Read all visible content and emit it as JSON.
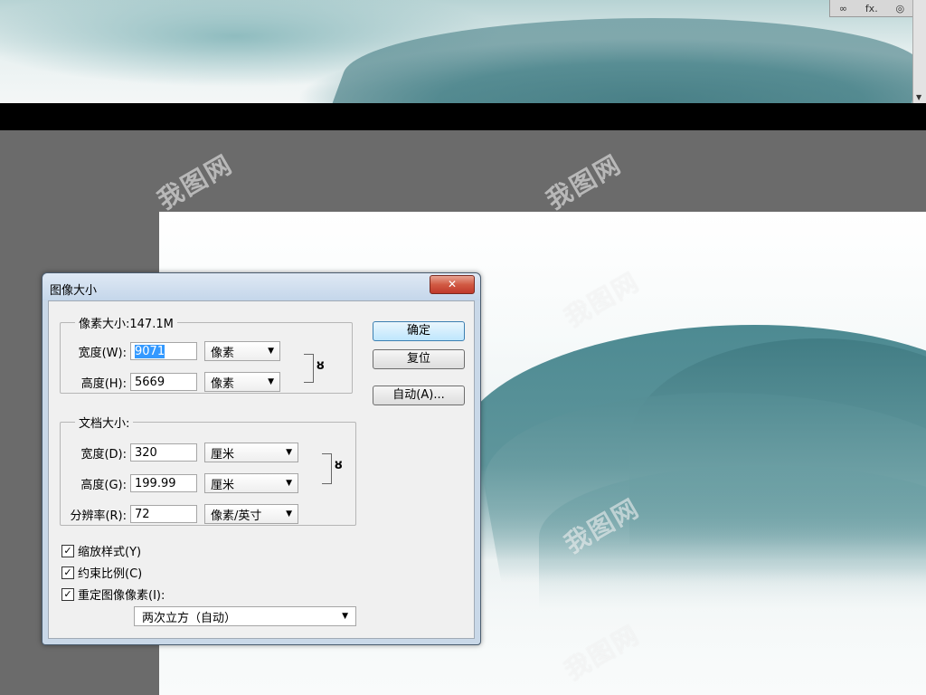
{
  "top_panel": {
    "link_icon": "link-icon",
    "fx_label": "fx",
    "buttons": [
      "∞",
      "fx.",
      "◎"
    ]
  },
  "dialog": {
    "title": "图像大小",
    "close_label": "✕",
    "pixel_dimensions": {
      "legend": "像素大小:147.1M",
      "width": {
        "label": "宽度(W):",
        "value": "9071",
        "unit": "像素"
      },
      "height": {
        "label": "高度(H):",
        "value": "5669",
        "unit": "像素"
      }
    },
    "document_size": {
      "legend": "文档大小:",
      "width": {
        "label": "宽度(D):",
        "value": "320",
        "unit": "厘米"
      },
      "height": {
        "label": "高度(G):",
        "value": "199.99",
        "unit": "厘米"
      },
      "resolution": {
        "label": "分辨率(R):",
        "value": "72",
        "unit": "像素/英寸"
      }
    },
    "buttons": {
      "ok": "确定",
      "reset": "复位",
      "auto": "自动(A)..."
    },
    "checkboxes": [
      {
        "label": "缩放样式(Y)",
        "checked": true
      },
      {
        "label": "约束比例(C)",
        "checked": true
      },
      {
        "label": "重定图像像素(I):",
        "checked": true
      }
    ],
    "resample_method": "两次立方（自动）"
  },
  "watermark_text": "我图网",
  "colors": {
    "accent": "#3399ff",
    "ridge": "#4d8a92",
    "close_red": "#c0392b"
  }
}
